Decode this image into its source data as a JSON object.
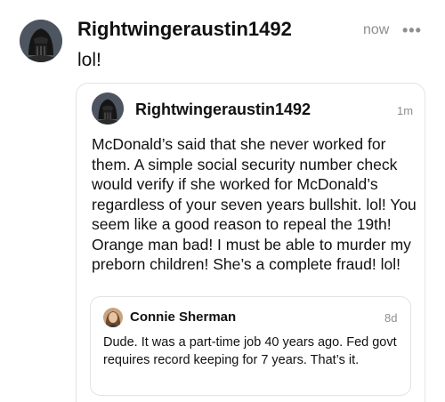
{
  "post": {
    "username": "Rightwingeraustin1492",
    "timestamp": "now",
    "more_icon": "more-horizontal-icon",
    "text": "lol!"
  },
  "quoted_post": {
    "username": "Rightwingeraustin1492",
    "timestamp": "1m",
    "text": "McDonald’s said that she never worked for them.  A simple social security number check would verify if she worked for McDonald’s regardless of your seven years bullshit. lol! You seem like a good reason to repeal the 19th! Orange man bad!  I must be able to murder my preborn children!  She’s  a complete fraud! lol!"
  },
  "nested_quote": {
    "username": "Connie Sherman",
    "timestamp": "8d",
    "text": "Dude. It was a part-time job 40 years ago. Fed govt requires record keeping for 7 years. That’s it."
  },
  "colors": {
    "text": "#111111",
    "secondary_text": "#8e8e93",
    "card_border": "#e3e3e6"
  }
}
